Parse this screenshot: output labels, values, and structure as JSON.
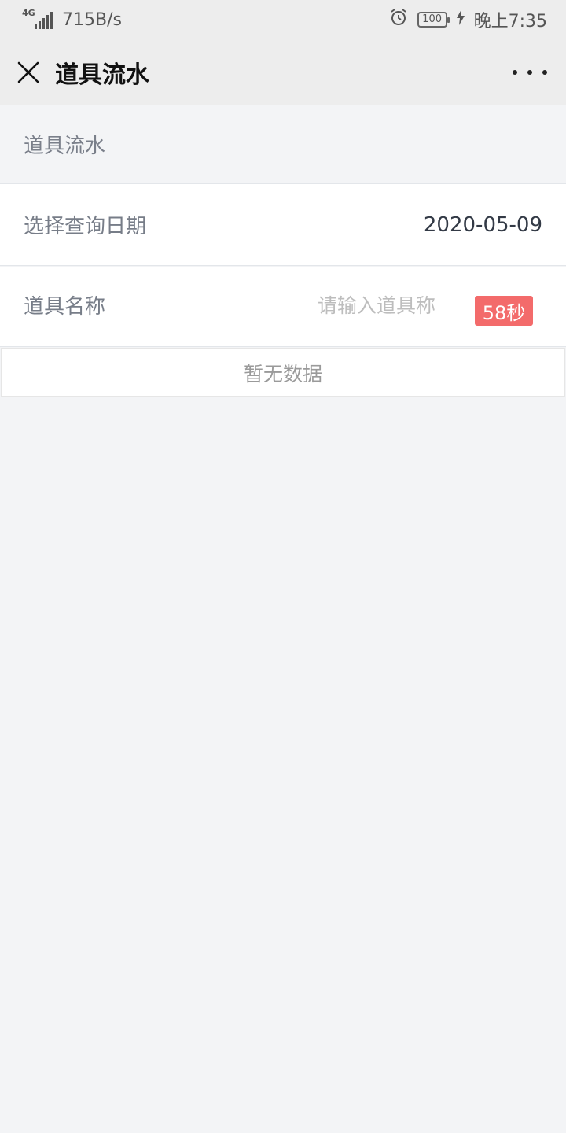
{
  "status_bar": {
    "network": "4G",
    "speed": "715B/s",
    "battery": "100",
    "time": "晚上7:35",
    "icons": [
      "signal-icon",
      "alarm-icon",
      "battery-icon",
      "charging-icon"
    ]
  },
  "nav": {
    "title": "道具流水",
    "close_icon": "close-icon",
    "more_icon": "more-icon"
  },
  "section": {
    "title": "道具流水"
  },
  "date_row": {
    "label": "选择查询日期",
    "value": "2020-05-09"
  },
  "name_row": {
    "label": "道具名称",
    "placeholder": "请输入道具称",
    "timer": "58秒"
  },
  "empty": {
    "text": "暂无数据"
  },
  "colors": {
    "badge": "#f36b6b",
    "background": "#f3f4f6",
    "navbar": "#ededed"
  }
}
